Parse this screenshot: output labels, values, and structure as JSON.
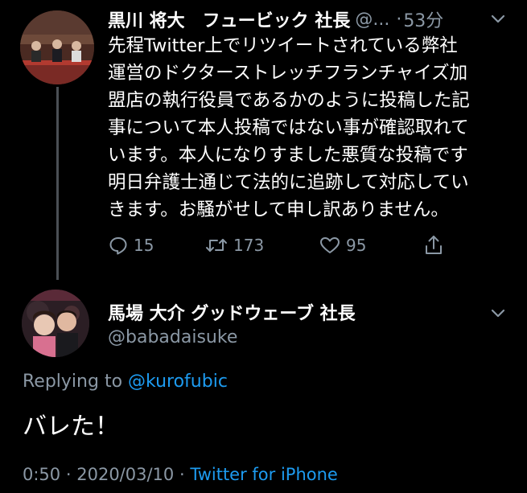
{
  "tweet1": {
    "name": "黒川 将大　フュービック 社長",
    "handle": "@...",
    "separator": "·",
    "time": "53分",
    "body_lines": [
      "先程Twitter上でリツイートされている弊社",
      "運営のドクターストレッチフランチャイズ加",
      "盟店の執行役員であるかのように投稿した記",
      "事について本人投稿ではない事が確認取れて",
      "います。本人になりすました悪質な投稿です",
      "明日弁護士通じて法的に追跡して対応してい",
      "きます。お騒がせして申し訳ありません。"
    ],
    "replies": "15",
    "retweets": "173",
    "likes": "95"
  },
  "tweet2": {
    "name": "馬場 大介 グッドウェーブ 社長",
    "handle": "@babadaisuke",
    "replying_prefix": "Replying to",
    "replying_handle": "@kurofubic",
    "body": "バレた！",
    "time": "0:50",
    "date": "2020/03/10",
    "meta_sep": "·",
    "app": "Twitter for iPhone"
  },
  "colors": {
    "background": "#000000",
    "text": "#ffffff",
    "secondary": "#8b98a5",
    "link": "#1d9bf0"
  },
  "icons": [
    "profile-avatar",
    "chevron-down-icon",
    "reply-icon",
    "retweet-icon",
    "like-icon",
    "share-icon"
  ]
}
